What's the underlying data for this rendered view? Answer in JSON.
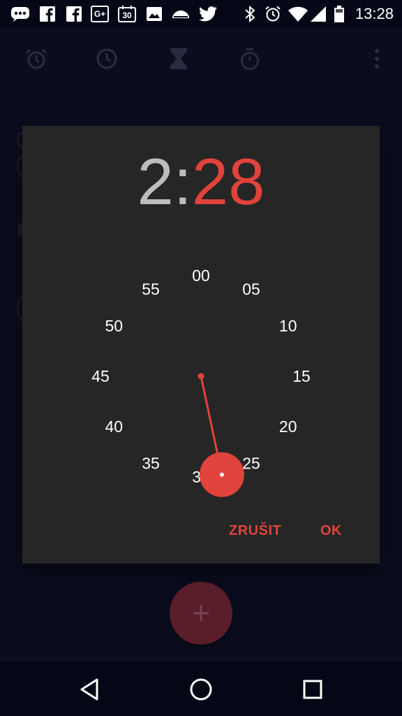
{
  "status_bar": {
    "time": "13:28",
    "left_icons": [
      "message-icon",
      "facebook-icon",
      "facebook-icon",
      "google-plus-icon",
      "calendar-icon",
      "image-icon",
      "cloud-icon",
      "twitter-icon"
    ],
    "calendar_day": "30",
    "google_plus_label": "G+",
    "right_icons": [
      "bluetooth-icon",
      "alarm-icon",
      "wifi-icon",
      "signal-icon",
      "battery-icon"
    ]
  },
  "app_tabs": [
    "alarm-tab-icon",
    "clock-tab-icon",
    "timer-tab-icon",
    "stopwatch-tab-icon",
    "more-options-icon"
  ],
  "time_picker": {
    "hour": "2",
    "separator": ":",
    "minute": "28",
    "dial_labels": [
      "00",
      "05",
      "10",
      "15",
      "20",
      "25",
      "30",
      "35",
      "40",
      "45",
      "50",
      "55"
    ],
    "selected_minute": 28,
    "accent_color": "#e0433b"
  },
  "actions": {
    "cancel_label": "ZRUŠIT",
    "ok_label": "OK"
  },
  "fab": {
    "icon": "plus-icon",
    "label": "+"
  },
  "nav_bar": [
    "back-icon",
    "home-icon",
    "recents-icon"
  ]
}
